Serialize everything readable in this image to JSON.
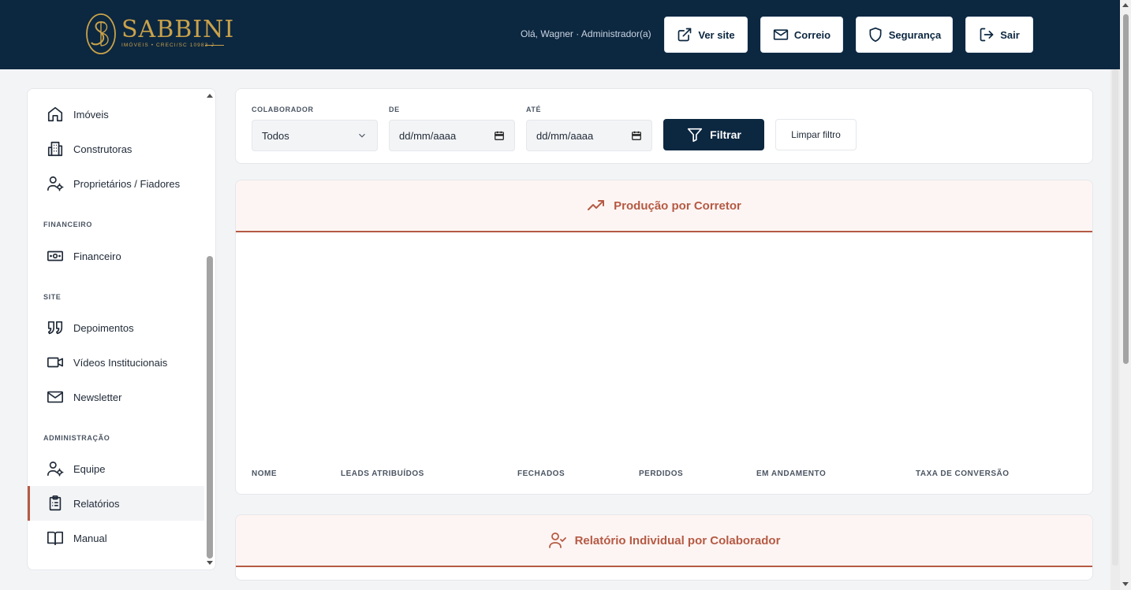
{
  "brand": {
    "name": "SABBINI",
    "subtitle": "IMÓVEIS • CRECI/SC 10983-J",
    "gold": "#c9a24a",
    "navy": "#0c2740",
    "accent": "#b55a44"
  },
  "header": {
    "greeting": "Olá, Wagner · Administrador(a)",
    "buttons": {
      "site": "Ver site",
      "mail": "Correio",
      "security": "Segurança",
      "logout": "Sair"
    }
  },
  "sidebar": {
    "items": {
      "imoveis": "Imóveis",
      "construtoras": "Construtoras",
      "proprietarios": "Proprietários / Fiadores",
      "financeiro": "Financeiro",
      "depoimentos": "Depoimentos",
      "videos": "Vídeos Institucionais",
      "newsletter": "Newsletter",
      "equipe": "Equipe",
      "relatorios": "Relatórios",
      "manual": "Manual"
    },
    "sections": {
      "financeiro": "FINANCEIRO",
      "site": "SITE",
      "administracao": "ADMINISTRAÇÃO"
    },
    "active": "Relatórios"
  },
  "filters": {
    "collaborator_label": "COLABORADOR",
    "collaborator_value": "Todos",
    "from_label": "DE",
    "from_value": "dd/mm/aaaa",
    "to_label": "ATÉ",
    "to_value": "dd/mm/aaaa",
    "filter_button": "Filtrar",
    "clear_button": "Limpar filtro"
  },
  "production": {
    "title": "Produção por Corretor",
    "columns": {
      "nome": "NOME",
      "leads": "LEADS ATRIBUÍDOS",
      "fechados": "FECHADOS",
      "perdidos": "PERDIDOS",
      "andamento": "EM ANDAMENTO",
      "taxa": "TAXA DE CONVERSÃO"
    }
  },
  "individual": {
    "title": "Relatório Individual por Colaborador"
  }
}
